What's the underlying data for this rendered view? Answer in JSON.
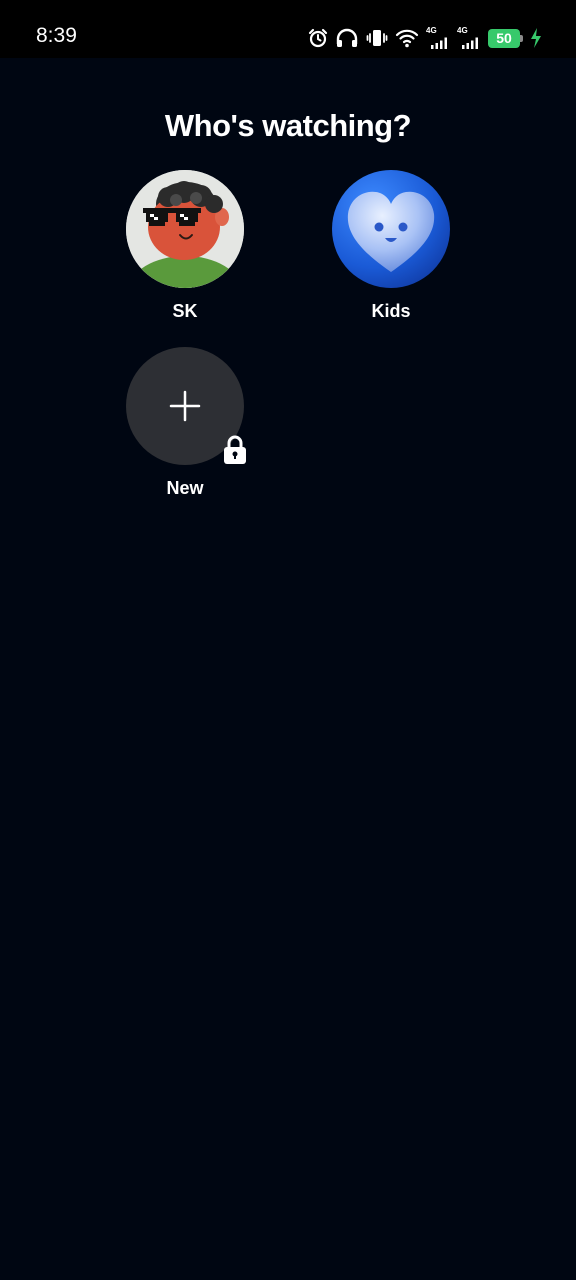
{
  "status_bar": {
    "time": "8:39",
    "network_1": "4G",
    "network_2": "4G",
    "battery": "50",
    "icons": [
      "alarm-icon",
      "headphones-icon",
      "vibrate-icon",
      "wifi-icon",
      "signal-icon",
      "signal-icon",
      "battery-icon",
      "charging-icon"
    ]
  },
  "screen": {
    "title": "Who's watching?"
  },
  "profiles": [
    {
      "name": "SK",
      "avatar": "cartoon-face-with-sunglasses"
    },
    {
      "name": "Kids",
      "avatar": "blue-heart-face"
    }
  ],
  "add_profile": {
    "label": "New",
    "icon": "plus-icon",
    "badge_icon": "lock-icon"
  },
  "colors": {
    "background": "#000612",
    "status_bar": "#000000",
    "battery": "#37c96b",
    "new_avatar": "#2d2f34",
    "kids_avatar": "#1a5ad6"
  }
}
